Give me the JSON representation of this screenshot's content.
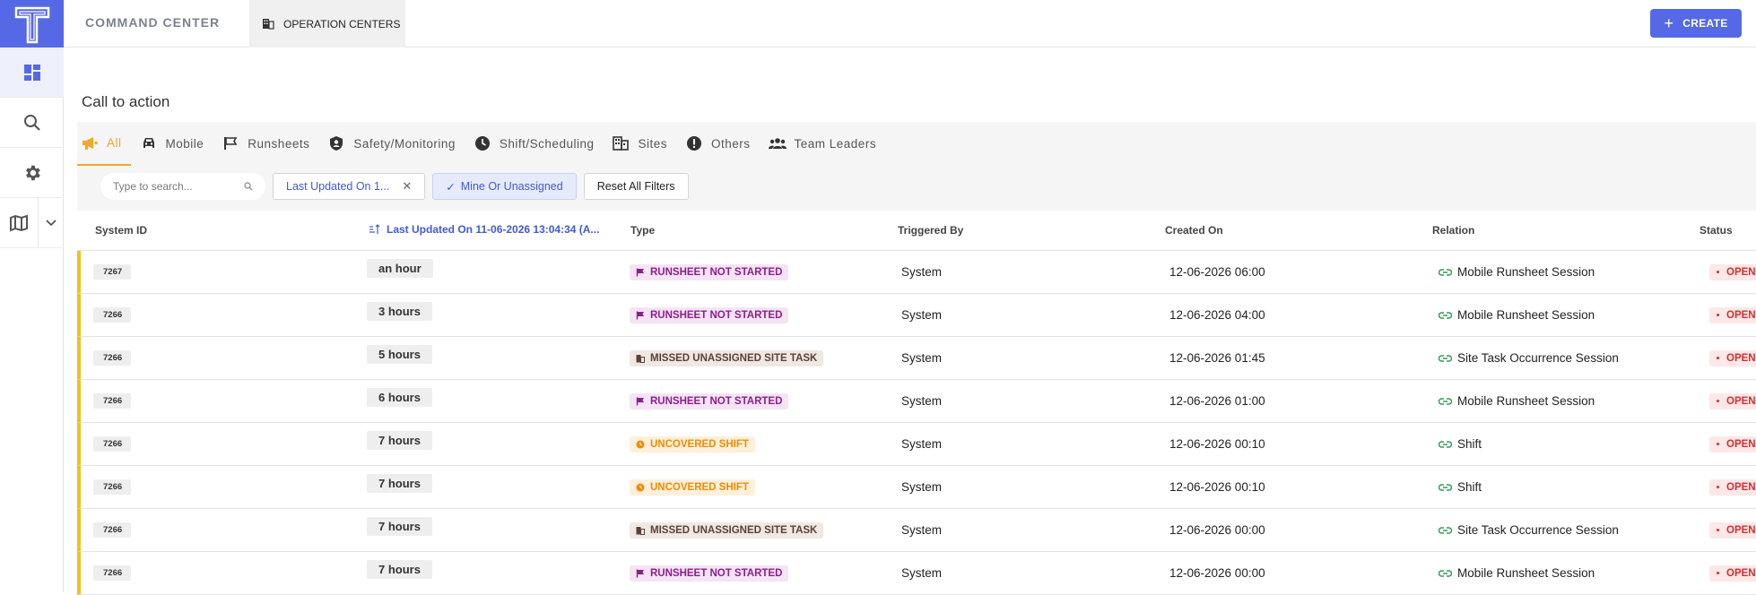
{
  "app": {
    "brand": "COMMAND CENTER",
    "logo_letter": "T"
  },
  "topbar": {
    "ops_tab_label": "OPERATION CENTERS",
    "create_label": "CREATE",
    "create_plus": "+"
  },
  "sidebar": {
    "items": [
      "dashboard-icon",
      "search-icon",
      "gear-icon",
      "map-icon"
    ]
  },
  "section": {
    "title": "Call to action"
  },
  "tabs": [
    {
      "label": "All",
      "icon": "megaphone-icon"
    },
    {
      "label": "Mobile",
      "icon": "car-icon"
    },
    {
      "label": "Runsheets",
      "icon": "flag-icon"
    },
    {
      "label": "Safety/Monitoring",
      "icon": "shield-icon"
    },
    {
      "label": "Shift/Scheduling",
      "icon": "clock-icon"
    },
    {
      "label": "Sites",
      "icon": "building-icon"
    },
    {
      "label": "Others",
      "icon": "alert-icon"
    },
    {
      "label": "Team Leaders",
      "icon": "people-icon"
    }
  ],
  "filters": {
    "search_placeholder": "Type to search...",
    "date_chip": "Last Updated On 1...",
    "date_chip_close": "✕",
    "mine_chip": "Mine Or Unassigned",
    "mine_check": "✓",
    "reset_label": "Reset All Filters"
  },
  "table": {
    "headers": {
      "system_id": "System ID",
      "last_updated": "Last Updated On 11-06-2026 13:04:34 (A...",
      "type": "Type",
      "triggered_by": "Triggered By",
      "created_on": "Created On",
      "relation": "Relation",
      "status": "Status"
    },
    "rows": [
      {
        "id": "7267",
        "updated": "an hour",
        "type": "RUNSHEET NOT STARTED",
        "trigger": "System",
        "created": "12-06-2026 06:00",
        "relation": "Mobile Runsheet Session",
        "status": "OPEN"
      },
      {
        "id": "7266",
        "updated": "3 hours",
        "type": "RUNSHEET NOT STARTED",
        "trigger": "System",
        "created": "12-06-2026 04:00",
        "relation": "Mobile Runsheet Session",
        "status": "OPEN"
      },
      {
        "id": "7266",
        "updated": "5 hours",
        "type": "MISSED UNASSIGNED SITE TASK",
        "trigger": "System",
        "created": "12-06-2026 01:45",
        "relation": "Site Task Occurrence Session",
        "status": "OPEN"
      },
      {
        "id": "7266",
        "updated": "6 hours",
        "type": "RUNSHEET NOT STARTED",
        "trigger": "System",
        "created": "12-06-2026 01:00",
        "relation": "Mobile Runsheet Session",
        "status": "OPEN"
      },
      {
        "id": "7266",
        "updated": "7 hours",
        "type": "UNCOVERED SHIFT",
        "trigger": "System",
        "created": "12-06-2026 00:10",
        "relation": "Shift",
        "status": "OPEN"
      },
      {
        "id": "7266",
        "updated": "7 hours",
        "type": "UNCOVERED SHIFT",
        "trigger": "System",
        "created": "12-06-2026 00:10",
        "relation": "Shift",
        "status": "OPEN"
      },
      {
        "id": "7266",
        "updated": "7 hours",
        "type": "MISSED UNASSIGNED SITE TASK",
        "trigger": "System",
        "created": "12-06-2026 00:00",
        "relation": "Site Task Occurrence Session",
        "status": "OPEN"
      },
      {
        "id": "7266",
        "updated": "7 hours",
        "type": "RUNSHEET NOT STARTED",
        "trigger": "System",
        "created": "12-06-2026 00:00",
        "relation": "Mobile Runsheet Session",
        "status": "OPEN"
      }
    ]
  },
  "colors": {
    "accent": "#5569e6",
    "active_tab": "#f5a623",
    "row_marker": "#f5bf1e",
    "status_open": "#d32f2f"
  }
}
